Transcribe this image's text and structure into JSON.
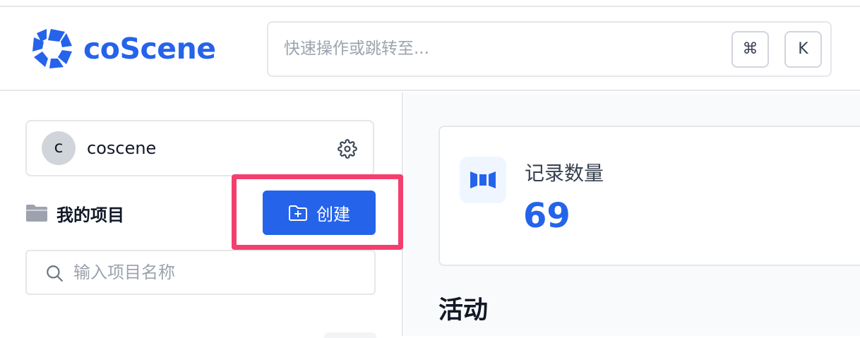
{
  "header": {
    "brand": "coScene",
    "search_placeholder": "快速操作或跳转至...",
    "shortcut_cmd": "⌘",
    "shortcut_key": "K"
  },
  "sidebar": {
    "org": {
      "avatar_letter": "c",
      "name": "coscene"
    },
    "projects_label": "我的项目",
    "create_button": "创建",
    "project_search_placeholder": "输入项目名称"
  },
  "main": {
    "stat": {
      "label": "记录数量",
      "value": "69"
    },
    "activity_title": "活动"
  },
  "colors": {
    "brand": "#2563eb",
    "highlight": "#f43f6e",
    "border": "#e5e7eb"
  },
  "icons": [
    "coscene-logo-icon",
    "gear-icon",
    "folder-icon",
    "folder-plus-icon",
    "search-icon",
    "record-icon"
  ]
}
